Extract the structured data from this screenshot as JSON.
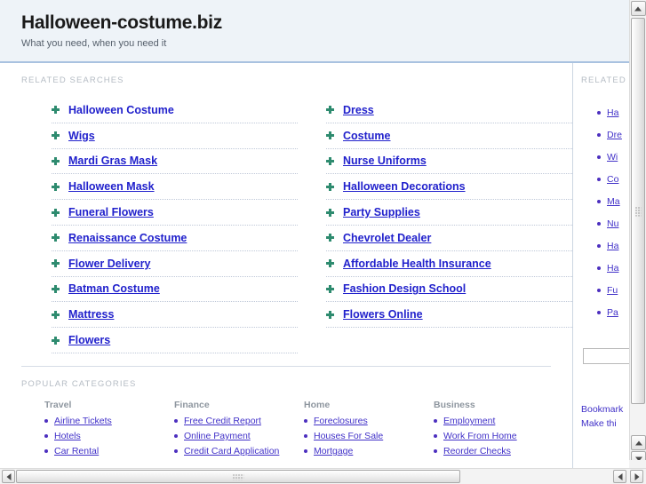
{
  "header": {
    "site_title": "Halloween-costume.biz",
    "tagline": "What you need, when you need it"
  },
  "main": {
    "related_searches_heading": "RELATED SEARCHES",
    "related_left": [
      "Halloween Costume",
      "Wigs",
      "Mardi Gras Mask",
      "Halloween Mask",
      "Funeral Flowers",
      "Renaissance Costume",
      "Flower Delivery",
      "Batman Costume",
      "Mattress",
      "Flowers"
    ],
    "related_right": [
      "Dress",
      "Costume",
      "Nurse Uniforms",
      "Halloween Decorations",
      "Party Supplies",
      "Chevrolet Dealer",
      "Affordable Health Insurance",
      "Fashion Design School",
      "Flowers Online"
    ],
    "popular_categories_heading": "POPULAR CATEGORIES",
    "categories": [
      {
        "title": "Travel",
        "items": [
          "Airline Tickets",
          "Hotels",
          "Car Rental"
        ]
      },
      {
        "title": "Finance",
        "items": [
          "Free Credit Report",
          "Online Payment",
          "Credit Card Application"
        ]
      },
      {
        "title": "Home",
        "items": [
          "Foreclosures",
          "Houses For Sale",
          "Mortgage"
        ]
      },
      {
        "title": "Business",
        "items": [
          "Employment",
          "Work From Home",
          "Reorder Checks"
        ]
      }
    ]
  },
  "aside": {
    "heading": "RELATED",
    "items": [
      "Ha",
      "Dre",
      "Wi",
      "Co",
      "Ma",
      "Nu",
      "Ha",
      "Ha",
      "Fu",
      "Pa"
    ],
    "search_value": "",
    "footer_line1": "Bookmark",
    "footer_line2": "Make thi"
  },
  "colors": {
    "link": "#2121cc",
    "small_link": "#4030c8",
    "bullet_star": "#2e8b6f",
    "header_bg": "#eef3f8",
    "header_rule": "#a9c2e0",
    "section_head": "#b5bcc4"
  }
}
